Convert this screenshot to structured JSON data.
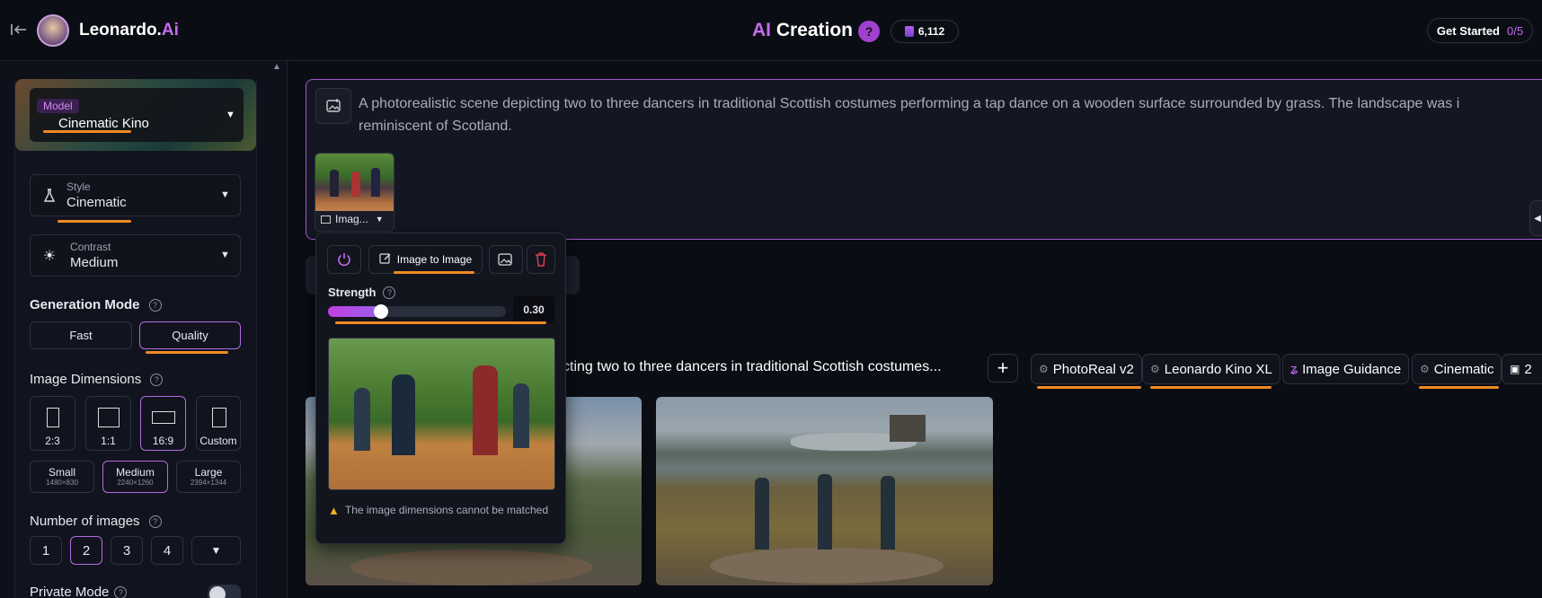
{
  "header": {
    "brand_main": "Leonardo.",
    "brand_ai": "Ai",
    "title_ai": "AI",
    "title_rest": " Creation",
    "help": "?",
    "credits": "6,112",
    "get_started": "Get Started",
    "get_started_progress": "0/5"
  },
  "sidebar": {
    "model_label": "Model",
    "model_value": "Cinematic Kino",
    "style_label": "Style",
    "style_value": "Cinematic",
    "contrast_label": "Contrast",
    "contrast_value": "Medium",
    "generation_mode_title": "Generation Mode",
    "mode_fast": "Fast",
    "mode_quality": "Quality",
    "image_dimensions_title": "Image Dimensions",
    "ratios": [
      "2:3",
      "1:1",
      "16:9",
      "Custom"
    ],
    "sizes": [
      {
        "name": "Small",
        "dims": "1480×830"
      },
      {
        "name": "Medium",
        "dims": "2240×1260"
      },
      {
        "name": "Large",
        "dims": "2394×1344"
      }
    ],
    "number_of_images_title": "Number of images",
    "counts": [
      "1",
      "2",
      "3",
      "4"
    ],
    "private_mode": "Private Mode"
  },
  "prompt": {
    "text_line1": "A photorealistic scene depicting two to three dancers in traditional Scottish costumes performing a tap dance on a wooden surface surrounded by grass. The landscape was i",
    "text_line2": "reminiscent of Scotland.",
    "thumb_label": "Imag..."
  },
  "popover": {
    "image_to_image": "Image to Image",
    "strength_label": "Strength",
    "strength_value": "0.30",
    "strength_fraction": 0.3,
    "warning": "The image dimensions cannot be matched"
  },
  "generation": {
    "prompt_preview": "cting two to three dancers in traditional Scottish costumes...",
    "chips": [
      "PhotoReal v2",
      "Leonardo Kino XL",
      "Image Guidance",
      "Cinematic"
    ],
    "count": "2"
  }
}
